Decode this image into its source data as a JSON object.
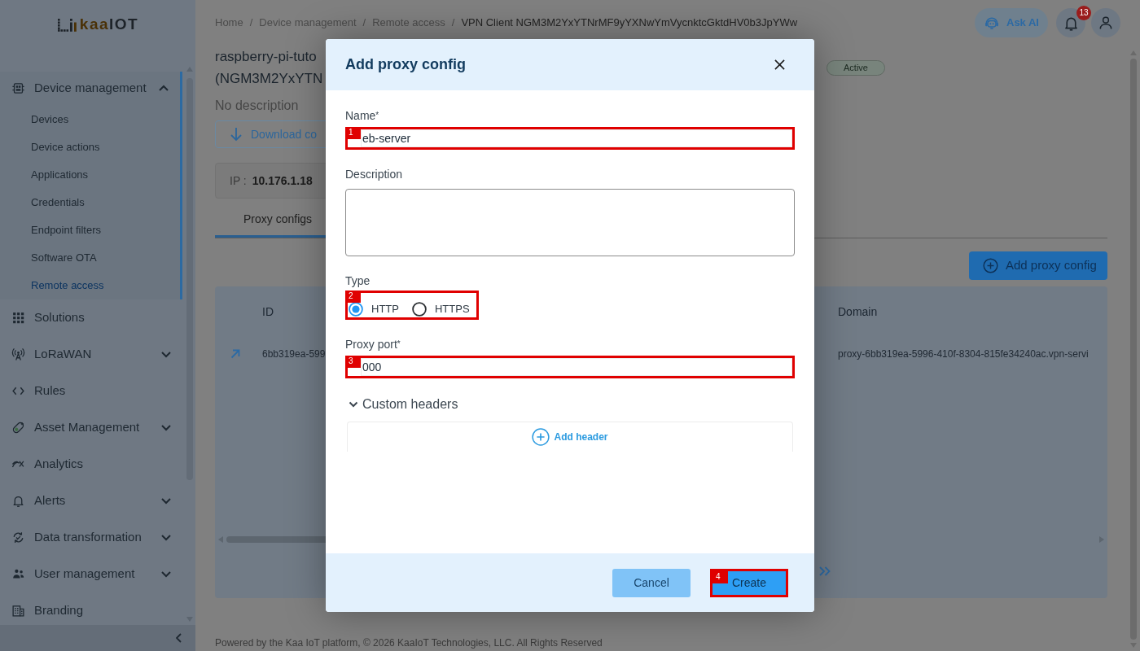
{
  "sidebar": {
    "logo": {
      "accent": "kaa",
      "text": "IOT"
    },
    "items": [
      {
        "label": "Device management",
        "kind": "group",
        "expanded": true,
        "children": [
          {
            "label": "Devices",
            "selected": false
          },
          {
            "label": "Device actions",
            "selected": false
          },
          {
            "label": "Applications",
            "selected": false
          },
          {
            "label": "Credentials",
            "selected": false
          },
          {
            "label": "Endpoint filters",
            "selected": false
          },
          {
            "label": "Software OTA",
            "selected": false
          },
          {
            "label": "Remote access",
            "selected": true
          }
        ]
      },
      {
        "label": "Solutions",
        "kind": "link"
      },
      {
        "label": "LoRaWAN",
        "kind": "group",
        "expanded": false
      },
      {
        "label": "Rules",
        "kind": "link"
      },
      {
        "label": "Asset Management",
        "kind": "group",
        "expanded": false
      },
      {
        "label": "Analytics",
        "kind": "link"
      },
      {
        "label": "Alerts",
        "kind": "group",
        "expanded": false
      },
      {
        "label": "Data transformation",
        "kind": "group",
        "expanded": false
      },
      {
        "label": "User management",
        "kind": "group",
        "expanded": false
      },
      {
        "label": "Branding",
        "kind": "link"
      }
    ]
  },
  "header": {
    "breadcrumb": {
      "separator": "/",
      "items": [
        "Home",
        "Device management",
        "Remote access",
        "VPN Client NGM3M2YxYTNrMF9yYXNwYmVycnktcGktdHV0b3JpYWw"
      ]
    },
    "ask_ai": "Ask AI",
    "notification_count": "13"
  },
  "device": {
    "title_lines": [
      "raspberry-pi-tuto",
      "(NGM3M2YxYTN"
    ],
    "status": "Active",
    "description": "No description",
    "download_button": "Download co",
    "ip_label": "IP :",
    "ip": "10.176.1.18"
  },
  "tabs": [
    {
      "label": "Proxy configs",
      "selected": true
    }
  ],
  "add_button": "Add proxy config",
  "table": {
    "columns": [
      "ID",
      "Domain"
    ],
    "rows": [
      {
        "cells": [
          "6bb319ea-599",
          "proxy-6bb319ea-5996-410f-8304-815fe34240ac.vpn-servi"
        ]
      }
    ]
  },
  "footer": "Powered by the Kaa IoT platform, © 2026 KaaIoT Technologies, LLC. All Rights Reserved",
  "dialog": {
    "title": "Add proxy config",
    "fields": [
      {
        "kind": "input",
        "label": "Name",
        "required_mark": "*",
        "value": "eb-server",
        "annotation": "1"
      },
      {
        "kind": "textarea",
        "label": "Description"
      },
      {
        "kind": "radio",
        "label": "Type",
        "annotation": "2",
        "options": [
          {
            "label": "HTTP",
            "selected": true
          },
          {
            "label": "HTTPS",
            "selected": false
          }
        ]
      },
      {
        "kind": "input",
        "label": "Proxy port",
        "required_mark": "*",
        "value": "000",
        "annotation": "3"
      }
    ],
    "custom_headers": {
      "label": "Custom headers",
      "expanded": true,
      "add_button": "Add header"
    },
    "buttons": [
      {
        "label": "Cancel",
        "kind": "secondary"
      },
      {
        "label": "Create",
        "kind": "primary",
        "annotation": "4"
      }
    ]
  }
}
